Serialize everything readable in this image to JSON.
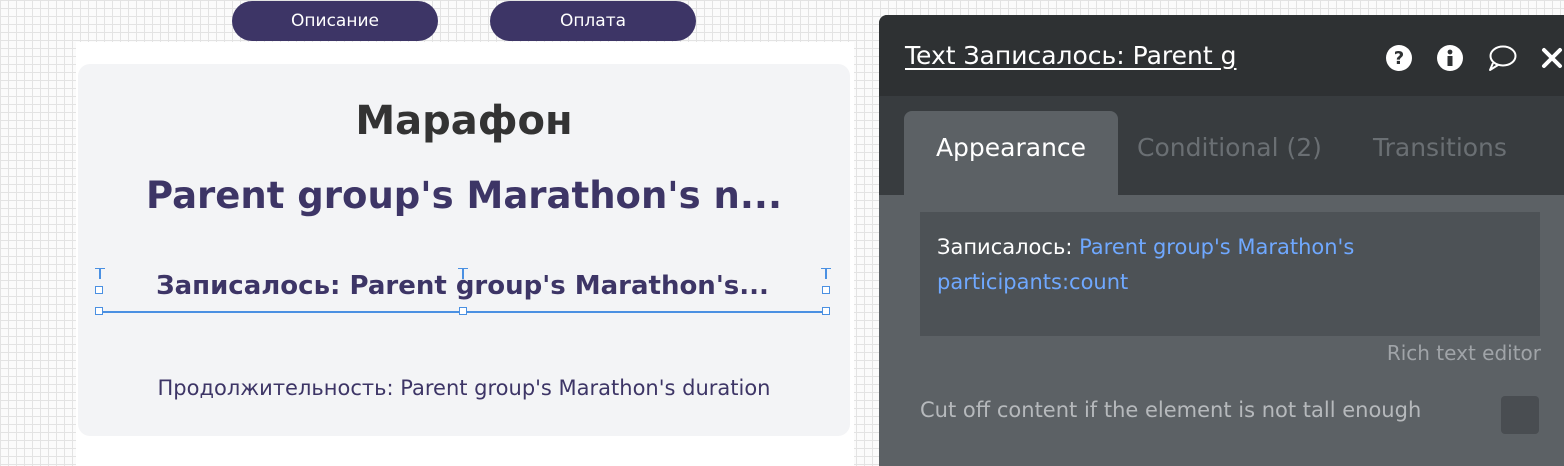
{
  "canvas": {
    "tabs": [
      {
        "label": "Описание"
      },
      {
        "label": "Оплата"
      }
    ],
    "card": {
      "title": "Марафон",
      "name": "Parent group's Marathon's n...",
      "enrolled_text": "Записалось: Parent group's Marathon's...",
      "duration_text": "Продолжительность: Parent group's Marathon's duration"
    }
  },
  "property_editor": {
    "title": "Text Записалось: Parent g",
    "header_icons": [
      "question-icon",
      "info-icon",
      "comment-icon",
      "close-icon"
    ],
    "tabs": {
      "appearance": "Appearance",
      "conditional": "Conditional (2)",
      "transitions": "Transitions"
    },
    "expression": {
      "static_part": "Записалось: ",
      "dynamic_part": "Parent group's Marathon's participants:count"
    },
    "rich_text_link": "Rich text editor",
    "cutoff_label": "Cut off content if the element is not tall enough",
    "cutoff_checked": false
  },
  "colors": {
    "brand": "#3d3566",
    "selection": "#4a90e2",
    "panel_bg": "#5c6165",
    "panel_header": "#2e3133",
    "dynamic_expression": "#6fa8ff"
  }
}
